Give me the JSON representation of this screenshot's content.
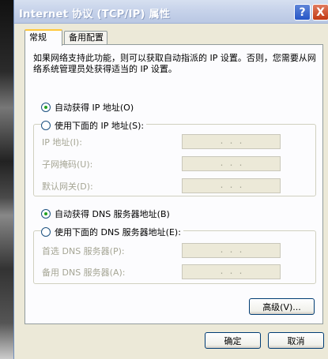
{
  "window": {
    "title": "Internet 协议 (TCP/IP) 属性",
    "help_symbol": "?",
    "close_symbol": "X"
  },
  "tabs": [
    {
      "label": "常规",
      "active": true
    },
    {
      "label": "备用配置",
      "active": false
    }
  ],
  "description": "如果网络支持此功能，则可以获取自动指派的 IP 设置。否则，您需要从网络系统管理员处获得适当的 IP 设置。",
  "ip_section": {
    "auto_option": {
      "label": "自动获得 IP 地址(O)",
      "checked": true
    },
    "manual_option": {
      "label": "使用下面的 IP 地址(S):",
      "checked": false
    },
    "fields": [
      {
        "label": "IP 地址(I):",
        "value": ".   .   ."
      },
      {
        "label": "子网掩码(U):",
        "value": ".   .   ."
      },
      {
        "label": "默认网关(D):",
        "value": ".   .   ."
      }
    ]
  },
  "dns_section": {
    "auto_option": {
      "label": "自动获得 DNS 服务器地址(B)",
      "checked": true
    },
    "manual_option": {
      "label": "使用下面的 DNS 服务器地址(E):",
      "checked": false
    },
    "fields": [
      {
        "label": "首选 DNS 服务器(P):",
        "value": ".   .   ."
      },
      {
        "label": "备用 DNS 服务器(A):",
        "value": ".   .   ."
      }
    ]
  },
  "buttons": {
    "advanced": "高级(V)...",
    "ok": "确定",
    "cancel": "取消"
  },
  "colors": {
    "window_bg": "#ece9d8",
    "panel_bg": "#fcfcfe",
    "disabled_text": "#a5a594",
    "title_text": "#ffffff",
    "tab_highlight": "#ffc83c",
    "radio_dot": "#21a121"
  }
}
